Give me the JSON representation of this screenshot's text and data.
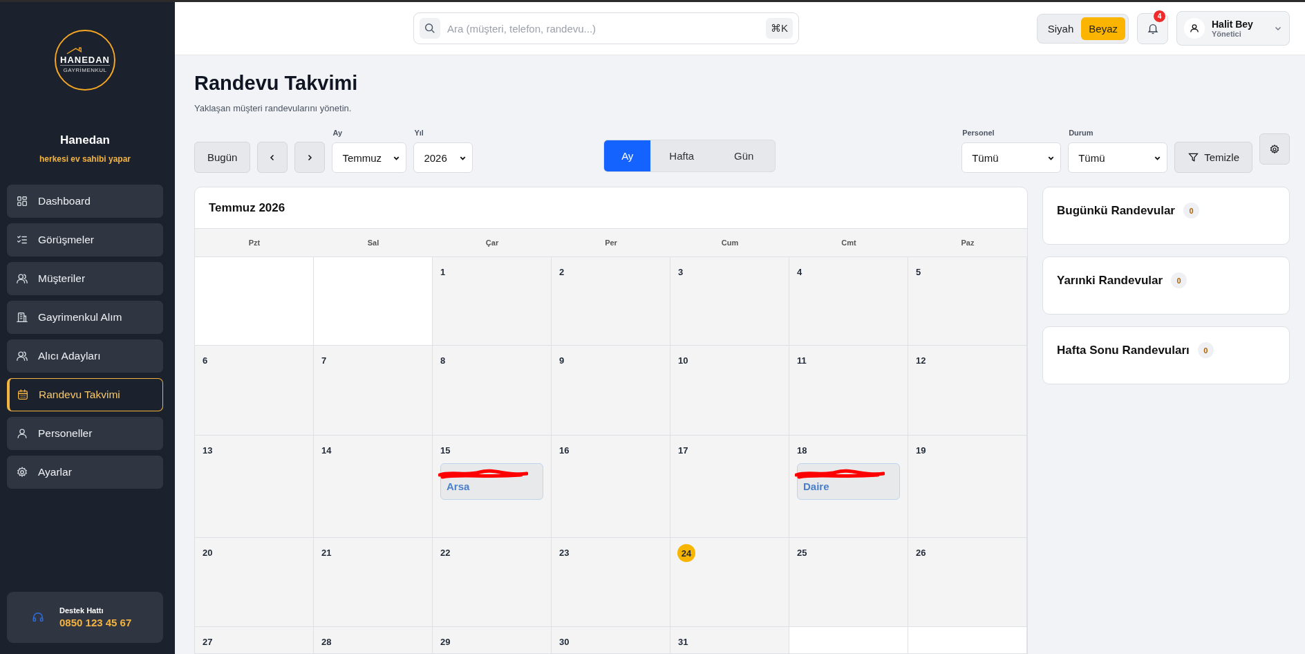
{
  "logo": {
    "name": "HANEDAN",
    "subtitle": "GAYRİMENKUL"
  },
  "brand": {
    "name": "Hanedan",
    "slogan": "herkesi ev sahibi yapar"
  },
  "nav": [
    {
      "label": "Dashboard",
      "selected": false
    },
    {
      "label": "Görüşmeler",
      "selected": false
    },
    {
      "label": "Müşteriler",
      "selected": false
    },
    {
      "label": "Gayrimenkul Alım",
      "selected": false
    },
    {
      "label": "Alıcı Adayları",
      "selected": false
    },
    {
      "label": "Randevu Takvimi",
      "selected": true
    },
    {
      "label": "Personeller",
      "selected": false
    },
    {
      "label": "Ayarlar",
      "selected": false
    }
  ],
  "support": {
    "title": "Destek Hattı",
    "phone": "0850 123 45 67"
  },
  "search": {
    "placeholder": "Ara (müşteri, telefon, randevu...)",
    "shortcut": "⌘K"
  },
  "theme": [
    {
      "label": "Siyah",
      "selected": false
    },
    {
      "label": "Beyaz",
      "selected": true
    }
  ],
  "notifications": {
    "count": "4"
  },
  "user": {
    "name": "Halit Bey",
    "role": "Yönetici"
  },
  "page": {
    "title": "Randevu Takvimi",
    "subtitle": "Yaklaşan müşteri randevularını yönetin."
  },
  "toolbar": {
    "today": "Bugün",
    "month": {
      "label": "Ay",
      "value": "Temmuz"
    },
    "year": {
      "label": "Yıl",
      "value": "2026"
    },
    "views": [
      {
        "label": "Ay",
        "selected": true
      },
      {
        "label": "Hafta",
        "selected": false
      },
      {
        "label": "Gün",
        "selected": false
      }
    ],
    "filters": [
      {
        "label": "Personel",
        "value": "Tümü"
      },
      {
        "label": "Durum",
        "value": "Tümü"
      }
    ],
    "clear": "Temizle"
  },
  "calendar": {
    "title": "Temmuz 2026",
    "weekdays": [
      "Pzt",
      "Sal",
      "Çar",
      "Per",
      "Cum",
      "Cmt",
      "Paz"
    ],
    "weeks": [
      [
        {
          "kind": "empty"
        },
        {
          "kind": "empty"
        },
        {
          "kind": "day",
          "day": "1",
          "today": false
        },
        {
          "kind": "day",
          "day": "2",
          "today": false
        },
        {
          "kind": "day",
          "day": "3",
          "today": false
        },
        {
          "kind": "day",
          "day": "4",
          "today": false
        },
        {
          "kind": "day",
          "day": "5",
          "today": false
        }
      ],
      [
        {
          "kind": "day",
          "day": "6",
          "today": false
        },
        {
          "kind": "day",
          "day": "7",
          "today": false
        },
        {
          "kind": "day",
          "day": "8",
          "today": false
        },
        {
          "kind": "day",
          "day": "9",
          "today": false
        },
        {
          "kind": "day",
          "day": "10",
          "today": false
        },
        {
          "kind": "day",
          "day": "11",
          "today": false
        },
        {
          "kind": "day",
          "day": "12",
          "today": false
        }
      ],
      [
        {
          "kind": "day",
          "day": "13",
          "today": false
        },
        {
          "kind": "day",
          "day": "14",
          "today": false
        },
        {
          "kind": "day",
          "day": "15",
          "today": false,
          "events": [
            {
              "label": "Arsa",
              "redacted": true
            }
          ]
        },
        {
          "kind": "day",
          "day": "16",
          "today": false
        },
        {
          "kind": "day",
          "day": "17",
          "today": false
        },
        {
          "kind": "day",
          "day": "18",
          "today": false,
          "events": [
            {
              "label": "Daire",
              "redacted": true
            }
          ]
        },
        {
          "kind": "day",
          "day": "19",
          "today": false
        }
      ],
      [
        {
          "kind": "day",
          "day": "20",
          "today": false
        },
        {
          "kind": "day",
          "day": "21",
          "today": false
        },
        {
          "kind": "day",
          "day": "22",
          "today": false
        },
        {
          "kind": "day",
          "day": "23",
          "today": false
        },
        {
          "kind": "day",
          "day": "24",
          "today": true
        },
        {
          "kind": "day",
          "day": "25",
          "today": false
        },
        {
          "kind": "day",
          "day": "26",
          "today": false
        }
      ],
      [
        {
          "kind": "day",
          "day": "27",
          "today": false
        },
        {
          "kind": "day",
          "day": "28",
          "today": false
        },
        {
          "kind": "day",
          "day": "29",
          "today": false
        },
        {
          "kind": "day",
          "day": "30",
          "today": false
        },
        {
          "kind": "day",
          "day": "31",
          "today": false
        },
        {
          "kind": "empty"
        },
        {
          "kind": "empty"
        }
      ]
    ]
  },
  "summaries": [
    {
      "title": "Bugünkü Randevular",
      "count": "0"
    },
    {
      "title": "Yarınki Randevular",
      "count": "0"
    },
    {
      "title": "Hafta Sonu Randevuları",
      "count": "0"
    }
  ]
}
